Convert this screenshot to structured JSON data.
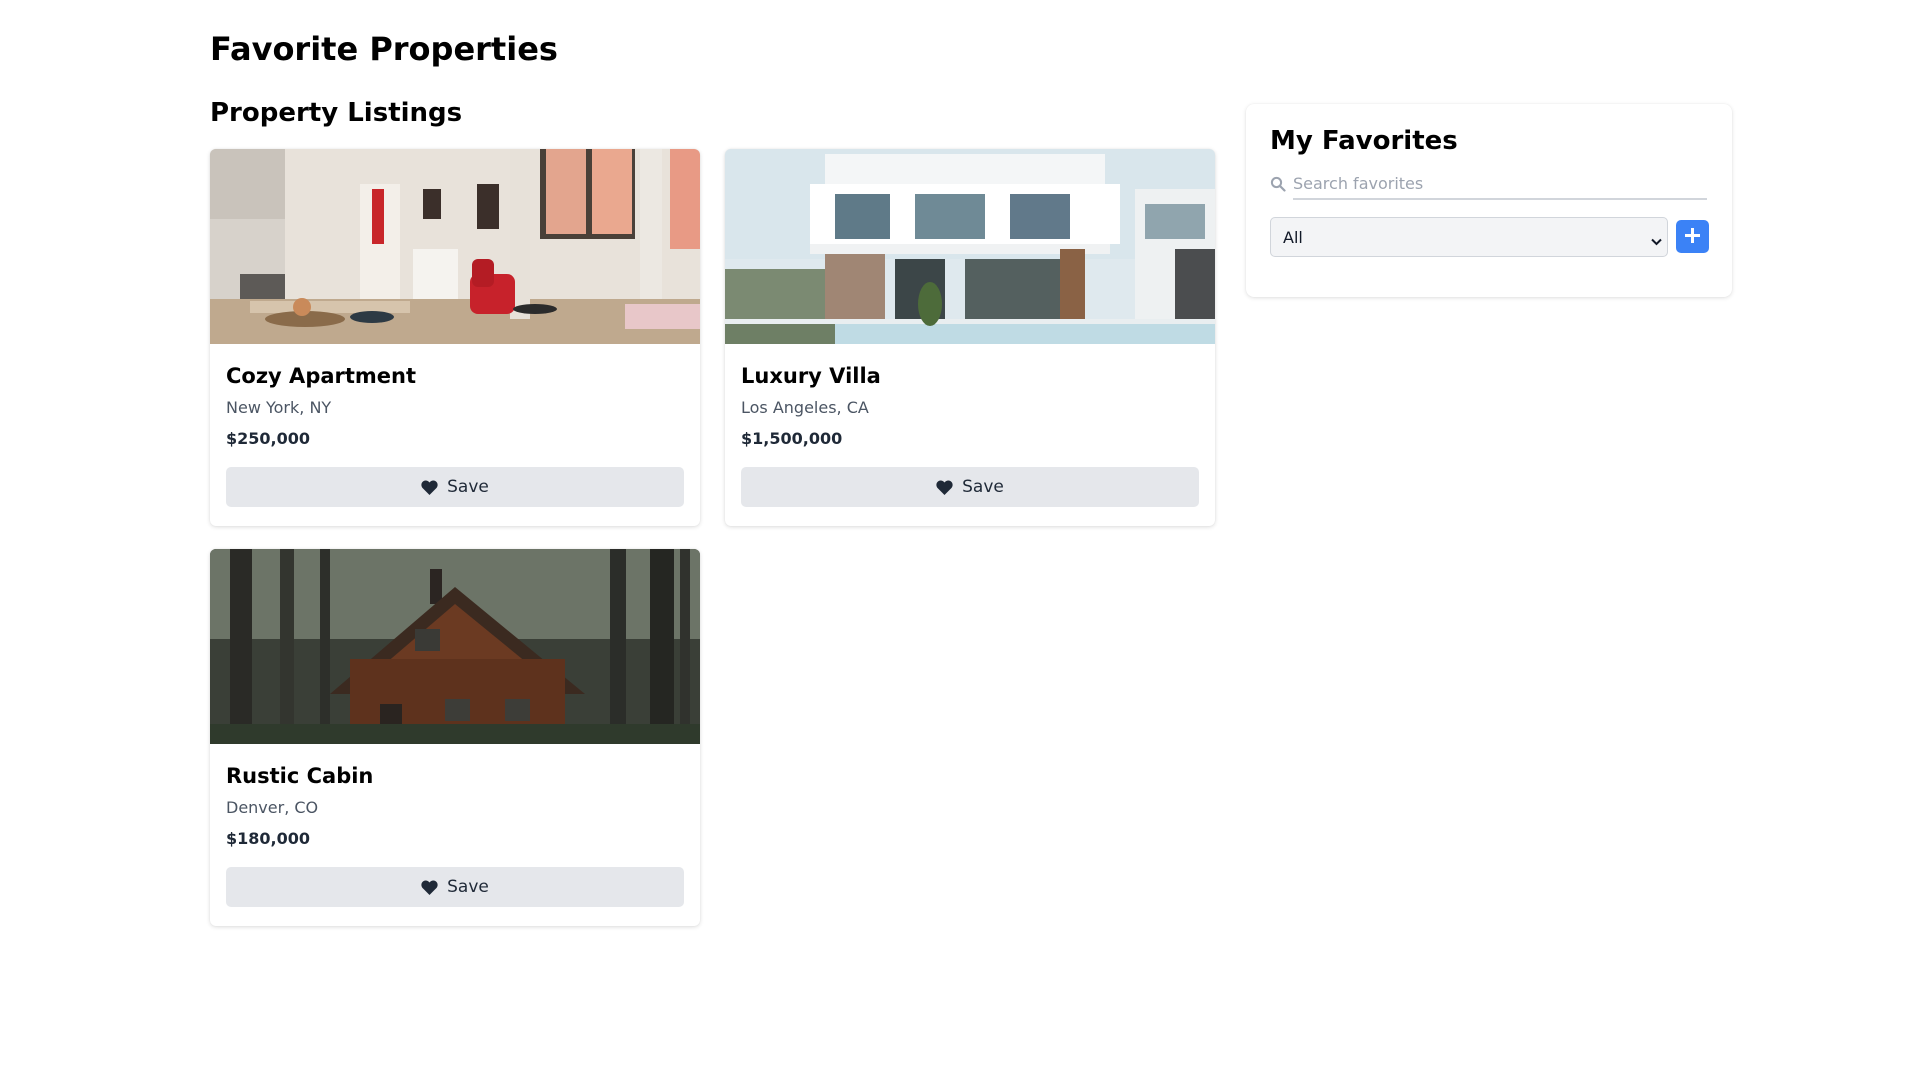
{
  "page": {
    "title": "Favorite Properties"
  },
  "listings": {
    "heading": "Property Listings",
    "items": [
      {
        "title": "Cozy Apartment",
        "location": "New York, NY",
        "price": "$250,000",
        "save_label": "Save",
        "image": "apartment-interior-photo"
      },
      {
        "title": "Luxury Villa",
        "location": "Los Angeles, CA",
        "price": "$1,500,000",
        "save_label": "Save",
        "image": "modern-villa-photo"
      },
      {
        "title": "Rustic Cabin",
        "location": "Denver, CO",
        "price": "$180,000",
        "save_label": "Save",
        "image": "forest-cabin-photo"
      }
    ]
  },
  "favorites": {
    "title": "My Favorites",
    "search_placeholder": "Search favorites",
    "filter_options": [
      "All"
    ],
    "filter_selected": "All",
    "icons": {
      "search": "search-icon",
      "add": "plus-icon",
      "save": "heart-icon"
    }
  },
  "colors": {
    "accent": "#3b82f6",
    "button_bg": "#e5e7eb"
  }
}
